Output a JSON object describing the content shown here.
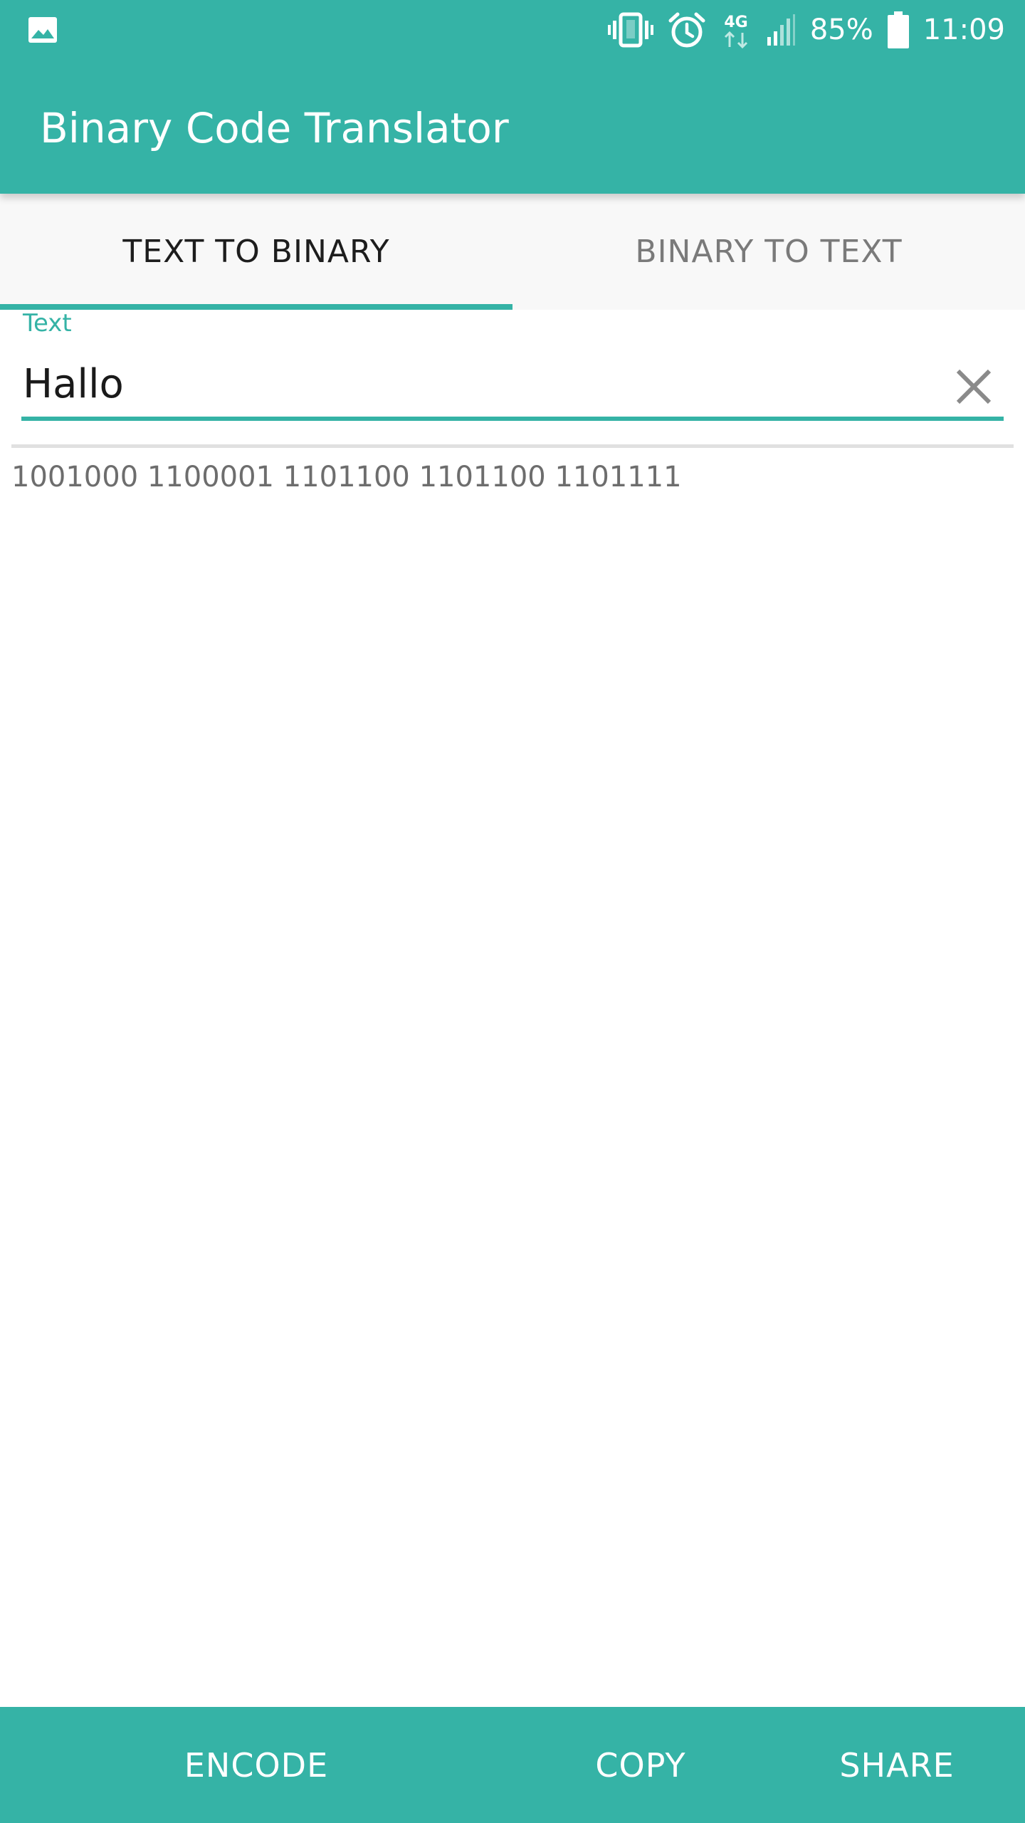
{
  "status_bar": {
    "gallery_icon": "image-icon",
    "vibrate_icon": "vibrate-icon",
    "alarm_icon": "alarm-icon",
    "network_label": "4G",
    "signal_icon": "signal-icon",
    "battery_percent": "85%",
    "battery_icon": "battery-icon",
    "time": "11:09"
  },
  "toolbar": {
    "title": "Binary Code Translator"
  },
  "tabs": [
    {
      "label": "TEXT TO BINARY",
      "selected": true
    },
    {
      "label": "BINARY TO TEXT",
      "selected": false
    }
  ],
  "input": {
    "label": "Text",
    "value": "Hallo",
    "clear_icon": "close-icon"
  },
  "output": {
    "text": "1001000 1100001 1101100 1101100 1101111"
  },
  "bottom_bar": {
    "encode_label": "ENCODE",
    "copy_label": "COPY",
    "share_label": "SHARE"
  },
  "colors": {
    "primary": "#35b3a6",
    "tab_background": "#f8f8f8",
    "output_text": "#6d6d6d"
  }
}
